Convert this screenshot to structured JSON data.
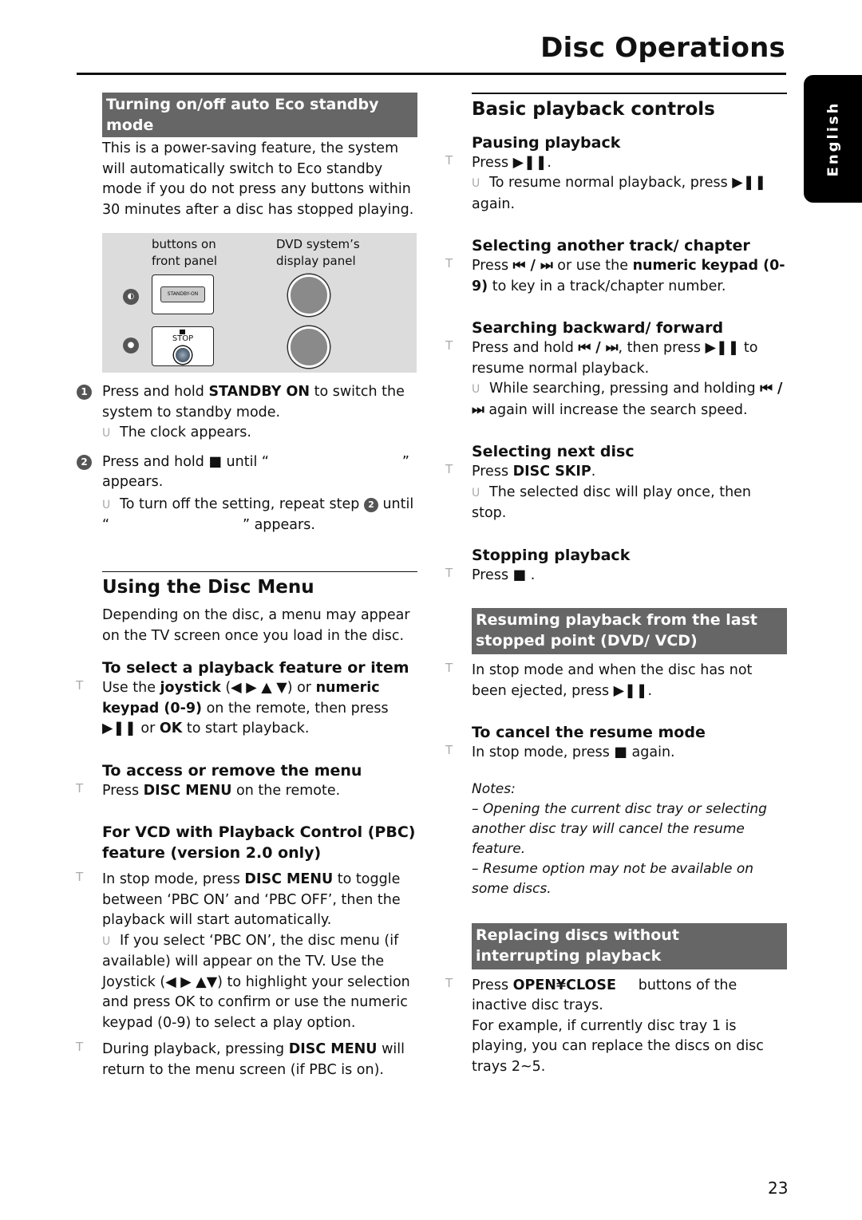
{
  "header": {
    "title": "Disc Operations",
    "language_tab": "English"
  },
  "left": {
    "eco": {
      "heading": "Turning on/off auto Eco standby mode",
      "intro": "This is a power-saving feature, the system will automatically switch to Eco standby mode if you do not press any buttons within 30 minutes after a disc has stopped playing.",
      "diagram": {
        "label_front": "buttons on front panel",
        "label_display": "DVD system’s display panel",
        "standby_button_text": "STANDBY-ON",
        "stop_button_text": "STOP"
      },
      "step1": {
        "num": "1",
        "pre": "Press and hold ",
        "bold": "STANDBY ON",
        "post": " to switch the system to standby mode.",
        "result": "The clock appears."
      },
      "step2": {
        "num": "2",
        "pre": "Press and hold ",
        "icon": "■",
        "post": " until “                              ” appears.",
        "result_pre": "To turn off the setting, repeat step ",
        "result_num": "2",
        "result_post": " until “                              ” appears."
      }
    },
    "disc_menu": {
      "title": "Using the Disc Menu",
      "intro": "Depending on the disc, a menu may appear on the TV screen once you load in the disc.",
      "select": {
        "heading": "To select a playback feature or item",
        "t1": "Use the ",
        "b1": "joystick",
        "t2": " (◀ ▶ ▲ ▼) or ",
        "b2": "numeric keypad (0-9)",
        "t3": " on the remote, then press ",
        "icon": "▶❚❚",
        "t4": " or ",
        "b3": "OK",
        "t5": " to start playback."
      },
      "access": {
        "heading": "To access or remove the menu",
        "t1": "Press ",
        "b1": "DISC MENU",
        "t2": " on the remote."
      },
      "pbc": {
        "heading": "For VCD with Playback Control (PBC) feature (version 2.0 only)",
        "t1": "In stop mode, press ",
        "b1": "DISC MENU",
        "t2": " to toggle between ‘PBC ON’ and ‘PBC OFF’, then the playback will start automatically.",
        "result": "If you select ‘PBC ON’, the disc menu (if available) will appear on the TV.  Use the Joystick (◀ ▶ ▲▼) to highlight your selection and press OK to confirm or use the numeric keypad (0-9) to select a play option.",
        "t3": "During playback, pressing ",
        "b2": "DISC MENU",
        "t4": " will return to the menu screen (if PBC is on)."
      }
    }
  },
  "right": {
    "basic": {
      "title": "Basic playback controls",
      "pause": {
        "heading": "Pausing playback",
        "t1": "Press ",
        "icon": "▶❚❚",
        "t2": ".",
        "result": "To resume normal playback, press ",
        "result_icon": "▶❚❚",
        "result_post": " again."
      },
      "track": {
        "heading": "Selecting another track/ chapter",
        "t1": "Press ",
        "icon": "⏮ / ⏭",
        "t2": " or use the ",
        "b1": "numeric keypad (0-9)",
        "t3": " to key in a track/chapter number."
      },
      "search": {
        "heading": "Searching backward/ forward",
        "t1": "Press and hold ",
        "icon": "⏮ / ⏭",
        "t2": ", then press ",
        "icon2": "▶❚❚",
        "t3": " to resume normal playback.",
        "result": "While searching, pressing and holding ",
        "result_icon": "⏮ / ⏭",
        "result_post": " again will increase the search speed."
      },
      "next": {
        "heading": "Selecting next disc",
        "t1": "Press ",
        "b1": "DISC SKIP",
        "t2": ".",
        "result": "The selected disc will play once, then stop."
      },
      "stop": {
        "heading": "Stopping playback",
        "t1": "Press ",
        "icon": "■",
        "t2": " ."
      }
    },
    "resume": {
      "heading": "Resuming playback from the last stopped point (DVD/ VCD)",
      "t1": "In stop mode and when the disc has not been ejected, press ",
      "icon": "▶❚❚",
      "t2": ".",
      "cancel": {
        "heading": "To cancel the resume mode",
        "t1": "In stop mode, press ",
        "icon": "■",
        "t2": " again."
      },
      "notes": {
        "label": "Notes:",
        "n1": "–  Opening the current disc tray or selecting another disc tray will cancel the resume feature.",
        "n2": "–  Resume option may not be available on some discs."
      }
    },
    "replace": {
      "heading": "Replacing discs without interrupting playback",
      "t1": "Press ",
      "b1": "OPEN¥CLOSE",
      "t2": "     buttons of the inactive disc trays.",
      "example": "For example, if currently disc tray 1 is playing, you can replace the discs on disc trays 2~5."
    }
  },
  "footer": {
    "page_number": "23"
  },
  "markers": {
    "bullet": "T",
    "result": "U"
  }
}
